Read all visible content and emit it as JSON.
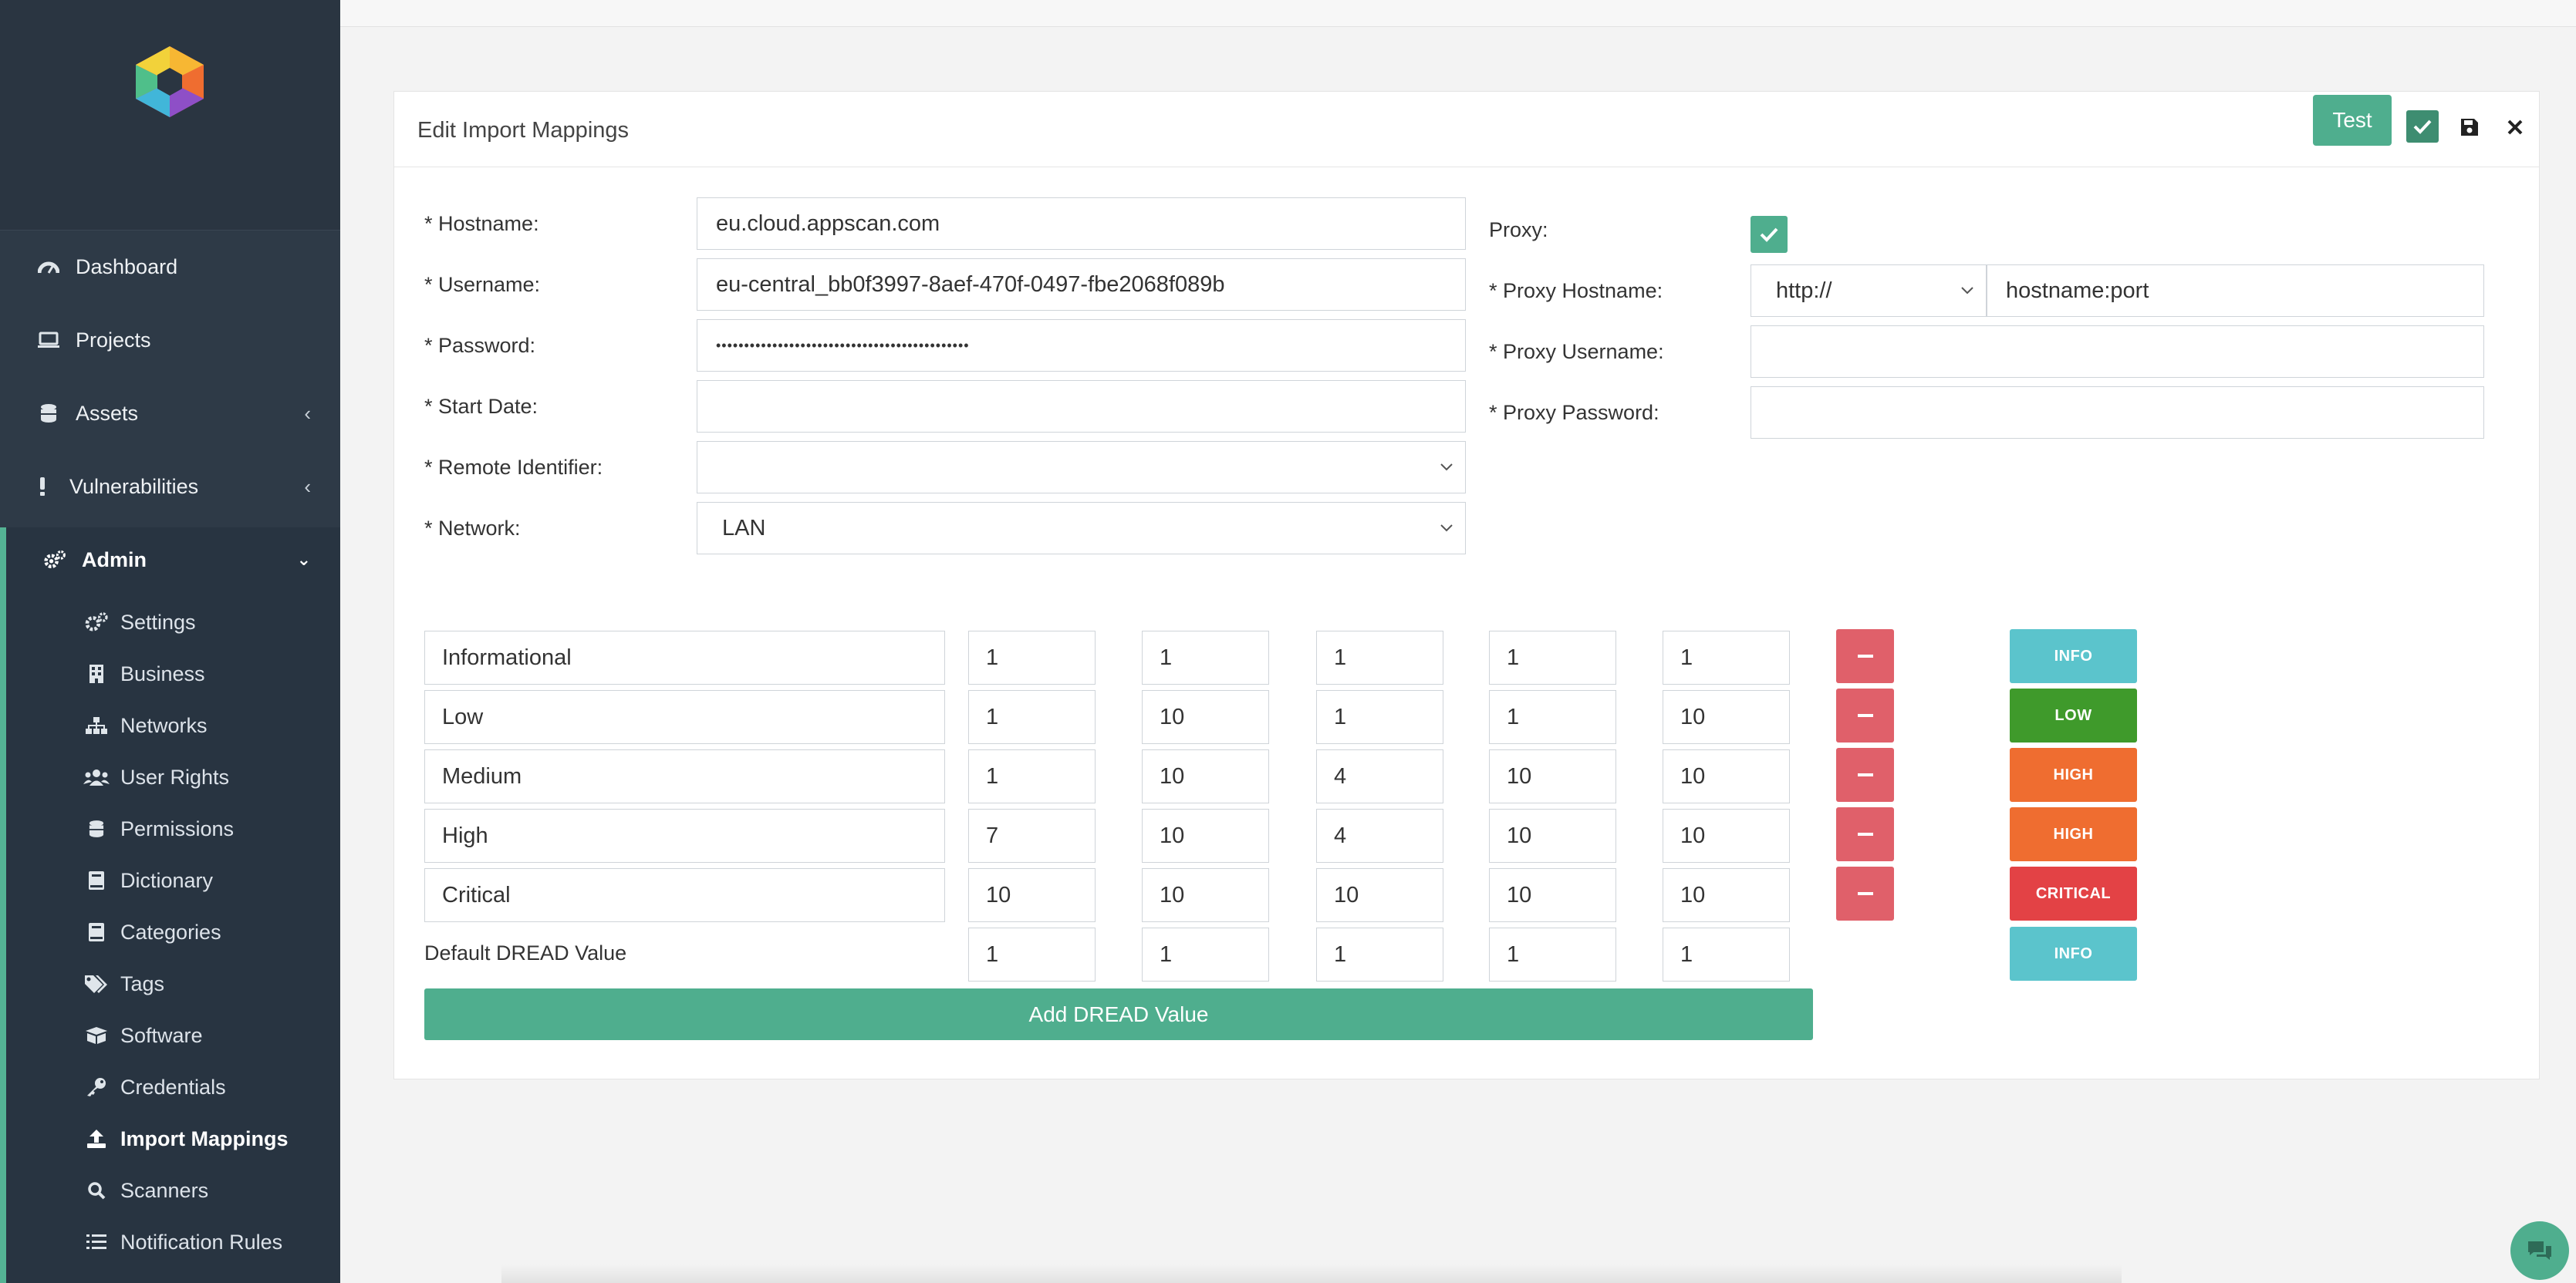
{
  "sidebar": {
    "logo": "app-logo",
    "nav": [
      {
        "label": "Dashboard",
        "icon": "dashboard-icon"
      },
      {
        "label": "Projects",
        "icon": "laptop-icon"
      },
      {
        "label": "Assets",
        "icon": "database-icon"
      },
      {
        "label": "Vulnerabilities",
        "icon": "exclamation-icon"
      },
      {
        "label": "Admin",
        "icon": "cogs-icon"
      }
    ],
    "admin_items": [
      {
        "label": "Settings",
        "icon": "cogs-icon"
      },
      {
        "label": "Business",
        "icon": "building-icon"
      },
      {
        "label": "Networks",
        "icon": "sitemap-icon"
      },
      {
        "label": "User Rights",
        "icon": "users-icon"
      },
      {
        "label": "Permissions",
        "icon": "database-icon"
      },
      {
        "label": "Dictionary",
        "icon": "book-icon"
      },
      {
        "label": "Categories",
        "icon": "book-icon"
      },
      {
        "label": "Tags",
        "icon": "tags-icon"
      },
      {
        "label": "Software",
        "icon": "box-icon"
      },
      {
        "label": "Credentials",
        "icon": "key-icon"
      },
      {
        "label": "Import Mappings",
        "icon": "upload-icon"
      },
      {
        "label": "Scanners",
        "icon": "search-icon"
      },
      {
        "label": "Notification Rules",
        "icon": "list-icon"
      }
    ],
    "active_item": "Import Mappings"
  },
  "card": {
    "title": "Edit Import Mappings",
    "test_label": "Test"
  },
  "form": {
    "hostname_label": "* Hostname:",
    "hostname_value": "eu.cloud.appscan.com",
    "username_label": "* Username:",
    "username_value": "eu-central_bb0f3997-8aef-470f-0497-fbe2068f089b",
    "password_label": "* Password:",
    "password_value": "•••••••••••••••••••••••••••••••••••••••••••••",
    "start_date_label": "* Start Date:",
    "start_date_value": "",
    "remote_identifier_label": "* Remote Identifier:",
    "remote_identifier_value": "",
    "network_label": "* Network:",
    "network_value": "LAN",
    "proxy_label": "Proxy:",
    "proxy_checked": true,
    "proxy_hostname_label": "* Proxy Hostname:",
    "proxy_scheme": "http://",
    "proxy_hostname_value": "hostname:port",
    "proxy_username_label": "* Proxy Username:",
    "proxy_username_value": "",
    "proxy_password_label": "* Proxy Password:",
    "proxy_password_value": ""
  },
  "dread": {
    "rows": [
      {
        "name": "Informational",
        "values": [
          "1",
          "1",
          "1",
          "1",
          "1"
        ],
        "badge": "INFO"
      },
      {
        "name": "Low",
        "values": [
          "1",
          "10",
          "1",
          "1",
          "10"
        ],
        "badge": "LOW"
      },
      {
        "name": "Medium",
        "values": [
          "1",
          "10",
          "4",
          "10",
          "10"
        ],
        "badge": "HIGH"
      },
      {
        "name": "High",
        "values": [
          "7",
          "10",
          "4",
          "10",
          "10"
        ],
        "badge": "HIGH"
      },
      {
        "name": "Critical",
        "values": [
          "10",
          "10",
          "10",
          "10",
          "10"
        ],
        "badge": "CRITICAL"
      }
    ],
    "default_label": "Default DREAD Value",
    "default_values": [
      "1",
      "1",
      "1",
      "1",
      "1"
    ],
    "default_badge": "INFO",
    "add_label": "Add DREAD Value"
  },
  "colors": {
    "accent": "#4fae8e",
    "danger": "#e0606a",
    "info": "#5bc4cc",
    "low": "#3f9a2b",
    "high": "#ef6d30",
    "critical": "#e34245",
    "sidebar": "#2e3a47"
  }
}
